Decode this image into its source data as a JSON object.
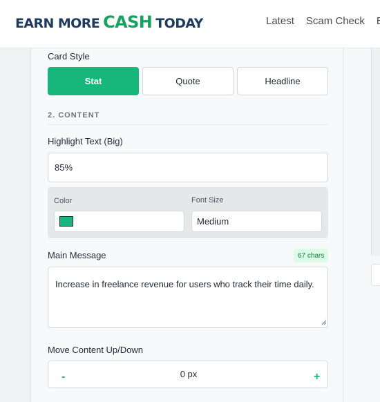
{
  "header": {
    "logo": {
      "part1": "EARN MORE",
      "part2": "CASH",
      "part3": "TODAY"
    },
    "nav": [
      "Latest",
      "Scam Check",
      "E"
    ]
  },
  "card_style": {
    "label": "Card Style",
    "options": [
      "Stat",
      "Quote",
      "Headline"
    ],
    "selected": "Stat"
  },
  "content_section": {
    "title": "2. CONTENT",
    "highlight": {
      "label": "Highlight Text (Big)",
      "value": "85%"
    },
    "color": {
      "label": "Color",
      "value": "#17b67a"
    },
    "font_size": {
      "label": "Font Size",
      "value": "Medium"
    },
    "main_message": {
      "label": "Main Message",
      "char_count": "67 chars",
      "value": "Increase in freelance revenue for users who track their time daily."
    },
    "move_content": {
      "label": "Move Content Up/Down",
      "minus": "-",
      "plus": "+",
      "value": "0 px"
    }
  },
  "colors": {
    "accent": "#17b67a",
    "brand_dark": "#1f3a5f"
  }
}
